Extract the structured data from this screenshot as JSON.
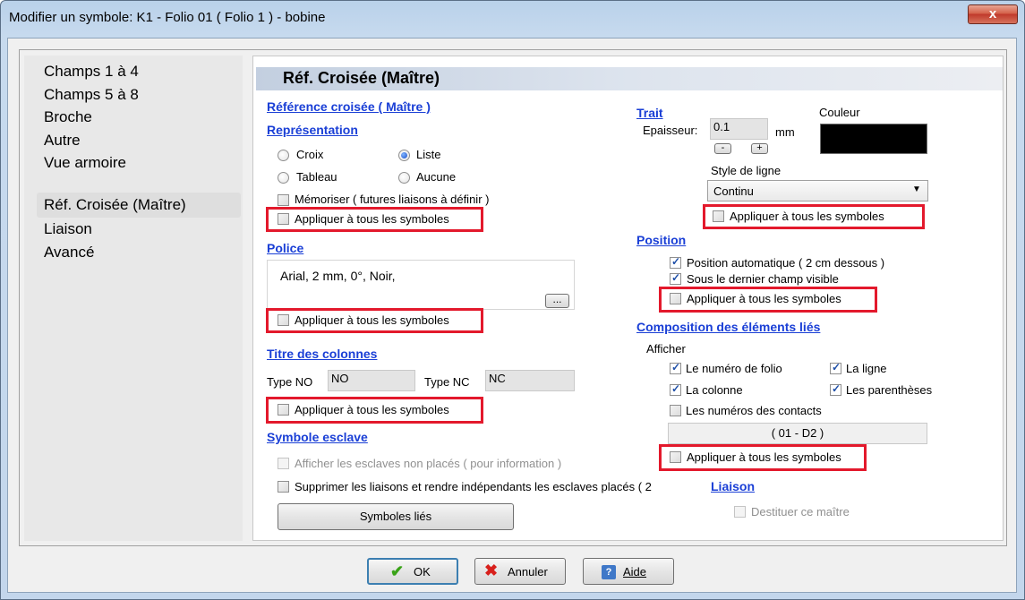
{
  "window": {
    "title": "Modifier un symbole: K1 - Folio 01 ( Folio 1 ) - bobine",
    "close": "x"
  },
  "sidebar": {
    "items": [
      {
        "label": "Champs 1 à 4"
      },
      {
        "label": "Champs 5 à 8"
      },
      {
        "label": "Broche"
      },
      {
        "label": "Autre"
      },
      {
        "label": "Vue armoire"
      },
      {
        "label": "Réf. Croisée (Maître)"
      },
      {
        "label": "Liaison"
      },
      {
        "label": "Avancé"
      }
    ],
    "selected": "Réf. Croisée (Maître)"
  },
  "panel": {
    "title": "Réf. Croisée (Maître)",
    "left": {
      "ref_heading": "Référence croisée ( Maître )",
      "rep_heading": "Représentation",
      "radio_croix": "Croix",
      "radio_liste": "Liste",
      "radio_tableau": "Tableau",
      "radio_aucune": "Aucune",
      "selected_radio": "Liste",
      "memoriser": "Mémoriser ( futures liaisons à définir )",
      "apply_all": "Appliquer à tous les symboles",
      "police_heading": "Police",
      "police_value": "Arial, 2 mm, 0°, Noir,",
      "police_btn": "...",
      "titre_heading": "Titre des colonnes",
      "type_no_label": "Type NO",
      "type_no_value": "NO",
      "type_nc_label": "Type NC",
      "type_nc_value": "NC",
      "esclave_heading": "Symbole esclave",
      "afficher_esclaves": "Afficher les esclaves non placés ( pour information )",
      "supprimer_liaisons": "Supprimer les liaisons et rendre indépendants les esclaves placés ( 2",
      "symboles_lies": "Symboles liés"
    },
    "right": {
      "trait_heading": "Trait",
      "couleur_label": "Couleur",
      "epaisseur_label": "Epaisseur:",
      "epaisseur_value": "0.1",
      "mm": "mm",
      "minus": "-",
      "plus": "+",
      "color_value": "#000000",
      "style_label": "Style de ligne",
      "style_value": "Continu",
      "position_heading": "Position",
      "pos_auto": "Position automatique ( 2 cm dessous )",
      "sous_dernier": "Sous le dernier champ visible",
      "composition_heading": "Composition des éléments liés",
      "afficher": "Afficher",
      "num_folio": "Le numéro de folio",
      "la_ligne": "La ligne",
      "la_colonne": "La colonne",
      "parentheses": "Les parenthèses",
      "num_contacts": "Les numéros des contacts",
      "preview": "( 01 - D2 )",
      "liaison_heading": "Liaison",
      "destituer": "Destituer ce maître"
    }
  },
  "footer": {
    "ok": "OK",
    "annuler": "Annuler",
    "aide": "Aide"
  },
  "colors": {
    "accent_link": "#1a3fd6",
    "highlight_box": "#e3192c"
  }
}
